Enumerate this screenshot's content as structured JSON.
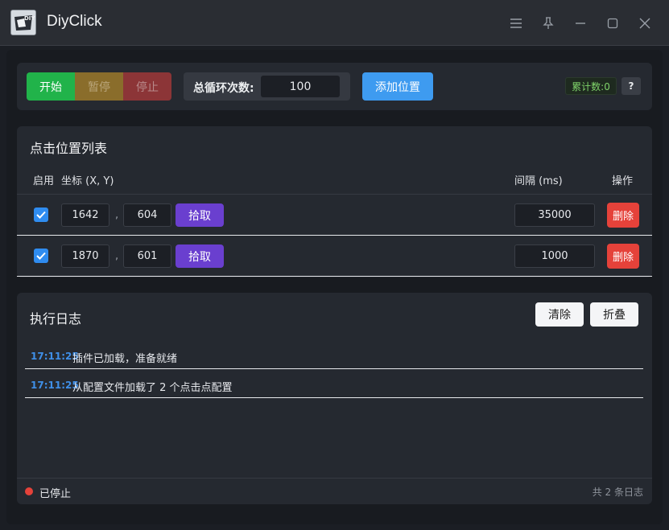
{
  "window": {
    "title": "DiyClick",
    "logo_text": "DIY"
  },
  "toolbar": {
    "start_label": "开始",
    "pause_label": "暂停",
    "stop_label": "停止",
    "loop_label": "总循环次数:",
    "loop_value": "100",
    "add_label": "添加位置",
    "counter_label": "累计数:0",
    "help_label": "?"
  },
  "positions": {
    "title": "点击位置列表",
    "headers": {
      "enable": "启用",
      "coords": "坐标 (X, Y)",
      "interval": "间隔 (ms)",
      "actions": "操作"
    },
    "rows": [
      {
        "enabled": true,
        "x": "1642",
        "y": "604",
        "pick_label": "拾取",
        "interval": "35000",
        "delete_label": "删除"
      },
      {
        "enabled": true,
        "x": "1870",
        "y": "601",
        "pick_label": "拾取",
        "interval": "1000",
        "delete_label": "删除"
      }
    ],
    "separator": ","
  },
  "log": {
    "title": "执行日志",
    "clear_label": "清除",
    "collapse_label": "折叠",
    "entries": [
      {
        "time": "17:11:25",
        "message": "插件已加载，准备就绪"
      },
      {
        "time": "17:11:25",
        "message": "从配置文件加载了 2 个点击点配置"
      }
    ]
  },
  "status": {
    "text": "已停止",
    "dot_color": "#e5423a",
    "log_count": "共 2 条日志"
  },
  "colors": {
    "accent": "#3e9bf0",
    "start": "#21b34a",
    "pick": "#6a3fcf",
    "delete": "#e5423a"
  }
}
